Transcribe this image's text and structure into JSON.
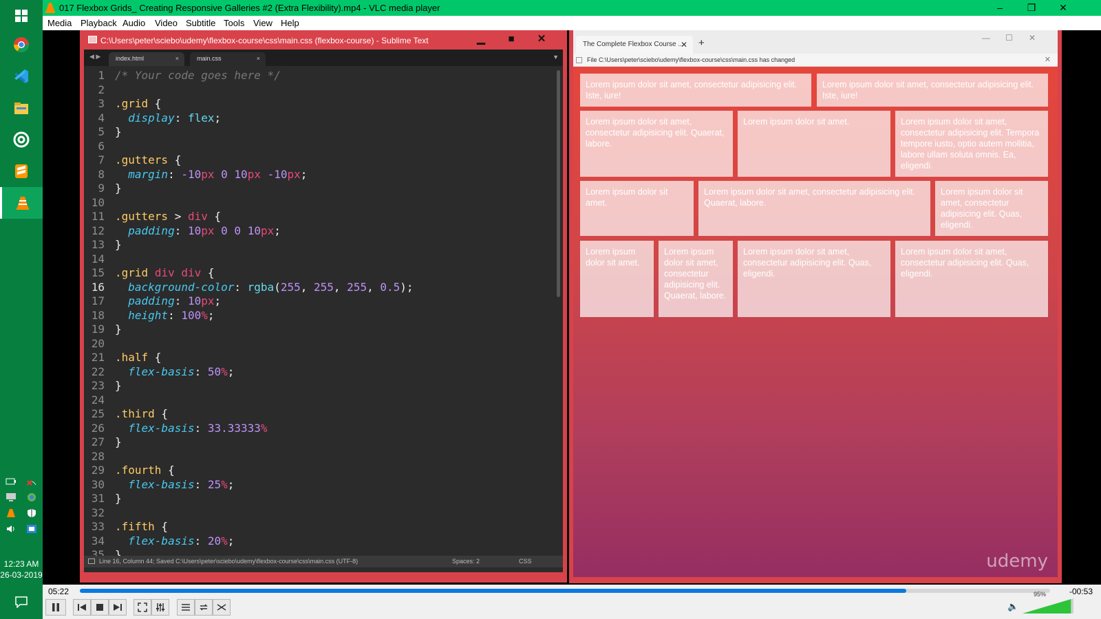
{
  "vlc": {
    "title": "017 Flexbox Grids_ Creating Responsive Galleries #2 (Extra Flexibility).mp4 - VLC media player",
    "menu": [
      "Media",
      "Playback",
      "Audio",
      "Video",
      "Subtitle",
      "Tools",
      "View",
      "Help"
    ],
    "window_controls": [
      "–",
      "❐",
      "✕"
    ],
    "time_current": "05:22",
    "time_remaining": "-00:53",
    "progress": 0.852,
    "volume_label": "95%",
    "volume_level": 0.95
  },
  "taskbar": {
    "icons": [
      "windows-icon",
      "chrome-icon",
      "vscode-icon",
      "file-explorer-icon",
      "target-app-icon",
      "sublime-icon",
      "vlc-icon"
    ],
    "clock_time": "12:23 AM",
    "clock_date": "26-03-2019"
  },
  "sublime": {
    "title": "C:\\Users\\peter\\sciebo\\udemy\\flexbox-course\\css\\main.css (flexbox-course) - Sublime Text",
    "tabs": [
      {
        "label": "index.html",
        "close": "×"
      },
      {
        "label": "main.css",
        "close": "×"
      }
    ],
    "status_left": "Line 16, Column 44; Saved C:\\Users\\peter\\sciebo\\udemy\\flexbox-course\\css\\main.css (UTF-8)",
    "status_spaces": "Spaces: 2",
    "status_syntax": "CSS",
    "code": [
      {
        "n": "1",
        "t": "/* Your code goes here */"
      },
      {
        "n": "2",
        "t": ""
      },
      {
        "n": "3",
        "t": ".grid {"
      },
      {
        "n": "4",
        "t": "  display: flex;"
      },
      {
        "n": "5",
        "t": "}"
      },
      {
        "n": "6",
        "t": ""
      },
      {
        "n": "7",
        "t": ".gutters {"
      },
      {
        "n": "8",
        "t": "  margin: -10px 0 10px -10px;"
      },
      {
        "n": "9",
        "t": "}"
      },
      {
        "n": "10",
        "t": ""
      },
      {
        "n": "11",
        "t": ".gutters > div {"
      },
      {
        "n": "12",
        "t": "  padding: 10px 0 0 10px;"
      },
      {
        "n": "13",
        "t": "}"
      },
      {
        "n": "14",
        "t": ""
      },
      {
        "n": "15",
        "t": ".grid div div {"
      },
      {
        "n": "16",
        "t": "  background-color: rgba(255, 255, 255, 0.5);"
      },
      {
        "n": "17",
        "t": "  padding: 10px;"
      },
      {
        "n": "18",
        "t": "  height: 100%;"
      },
      {
        "n": "19",
        "t": "}"
      },
      {
        "n": "20",
        "t": ""
      },
      {
        "n": "21",
        "t": ".half {"
      },
      {
        "n": "22",
        "t": "  flex-basis: 50%;"
      },
      {
        "n": "23",
        "t": "}"
      },
      {
        "n": "24",
        "t": ""
      },
      {
        "n": "25",
        "t": ".third {"
      },
      {
        "n": "26",
        "t": "  flex-basis: 33.33333%"
      },
      {
        "n": "27",
        "t": "}"
      },
      {
        "n": "28",
        "t": ""
      },
      {
        "n": "29",
        "t": ".fourth {"
      },
      {
        "n": "30",
        "t": "  flex-basis: 25%;"
      },
      {
        "n": "31",
        "t": "}"
      },
      {
        "n": "32",
        "t": ""
      },
      {
        "n": "33",
        "t": ".fifth {"
      },
      {
        "n": "34",
        "t": "  flex-basis: 20%;"
      },
      {
        "n": "35",
        "t": "}"
      }
    ]
  },
  "browser": {
    "tab_title": "The Complete Flexbox Course ...",
    "tab_close": "✕",
    "new_tab": "+",
    "notice": "File C:\\Users\\peter\\sciebo\\udemy\\flexbox-course\\css\\main.css has changed",
    "notice_close": "✕",
    "watermark": "udemy",
    "grid_rows": [
      [
        "Lorem ipsum dolor sit amet, consectetur adipisicing elit. Iste, iure!",
        "Lorem ipsum dolor sit amet, consectetur adipisicing elit. Iste, iure!"
      ],
      [
        "Lorem ipsum dolor sit amet, consectetur adipisicing elit. Quaerat, labore.",
        "Lorem ipsum dolor sit amet.",
        "Lorem ipsum dolor sit amet, consectetur adipisicing elit. Tempora tempore iusto, optio autem mollitia, labore ullam soluta omnis. Ea, eligendi."
      ],
      [
        "Lorem ipsum dolor sit amet.",
        "Lorem ipsum dolor sit amet, consectetur adipisicing elit. Quaerat, labore.",
        "Lorem ipsum dolor sit amet, consectetur adipisicing elit. Quas, eligendi."
      ],
      [
        "Lorem ipsum dolor sit amet.",
        "Lorem ipsum dolor sit amet, consectetur adipisicing elit. Quaerat, labore.",
        "Lorem ipsum dolor sit amet, consectetur adipisicing elit. Quas, eligendi.",
        "Lorem ipsum dolor sit amet, consectetur adipisicing elit. Quas, eligendi."
      ]
    ]
  },
  "colors": {
    "vlc_green": "#00c86a",
    "taskbar_green": "#07803f",
    "sublime_red": "#d8424a",
    "seek_blue": "#0a79e0"
  }
}
